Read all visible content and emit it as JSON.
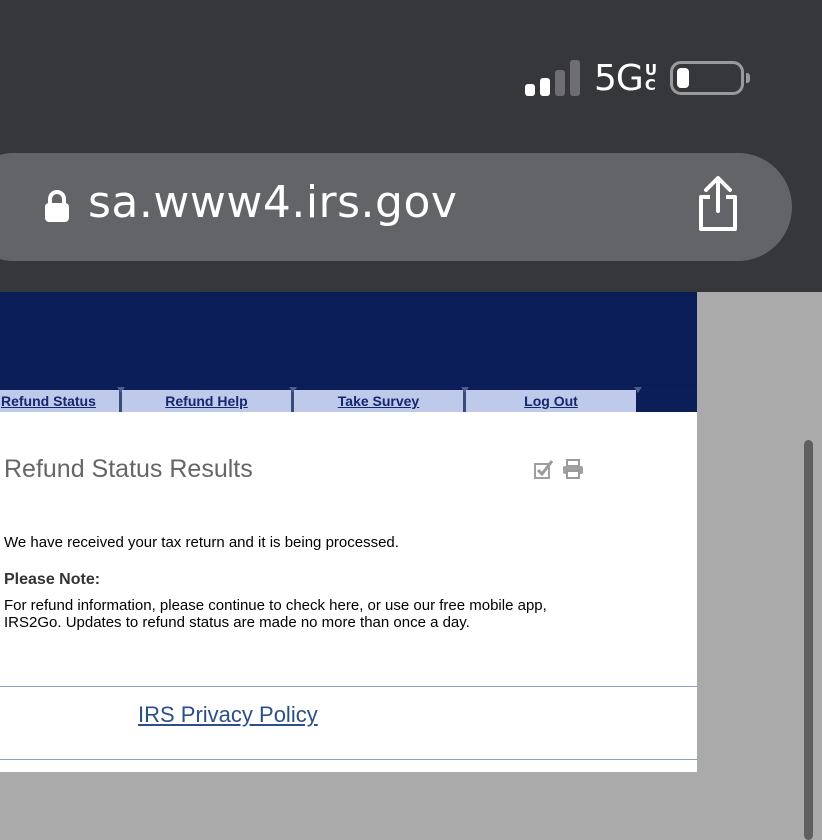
{
  "status_bar": {
    "network": "5G",
    "network_sub_top": "U",
    "network_sub_bottom": "C",
    "signal_bars_active": 2,
    "signal_bars_total": 4,
    "battery_level": 0.15
  },
  "browser": {
    "url": "sa.www4.irs.gov",
    "lock_icon": "lock-icon",
    "share_icon": "share-icon"
  },
  "nav": {
    "tabs": [
      {
        "label": "Refund Status"
      },
      {
        "label": "Refund Help"
      },
      {
        "label": "Take Survey"
      },
      {
        "label": "Log Out"
      }
    ]
  },
  "main": {
    "title": "Refund Status Results",
    "tools": [
      "checkmark-icon",
      "printer-icon"
    ],
    "message": "We have received your tax return and it is being processed.",
    "note_heading": "Please Note:",
    "note_body": "For refund information, please continue to check here, or use our free mobile app, IRS2Go. Updates to refund status are made no more than once a day."
  },
  "footer": {
    "privacy_link": "IRS Privacy Policy"
  },
  "colors": {
    "chrome": "#36373b",
    "url_bar": "#636468",
    "banner": "#0c1e58",
    "nav_tab": "#bfc9e9",
    "link": "#2c4f88"
  }
}
